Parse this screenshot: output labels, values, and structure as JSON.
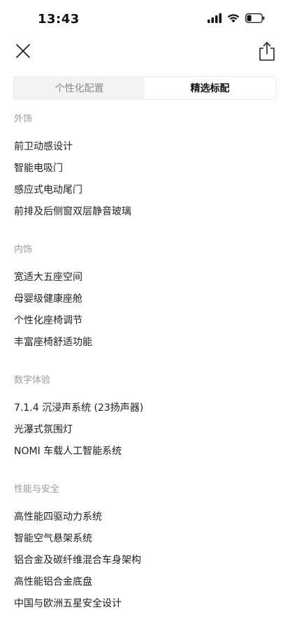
{
  "status_bar": {
    "time": "13:43"
  },
  "icons": {
    "close": "close-icon",
    "share": "share-icon",
    "signal": "signal-icon",
    "wifi": "wifi-icon",
    "battery": "battery-icon"
  },
  "tabs": [
    {
      "label": "个性化配置",
      "active": false
    },
    {
      "label": "精选标配",
      "active": true
    }
  ],
  "sections": [
    {
      "title": "外饰",
      "items": [
        "前卫动感设计",
        "智能电吸门",
        "感应式电动尾门",
        "前排及后侧窗双层静音玻璃"
      ]
    },
    {
      "title": "内饰",
      "items": [
        "宽适大五座空间",
        "母婴级健康座舱",
        "个性化座椅调节",
        "丰富座椅舒适功能"
      ]
    },
    {
      "title": "数字体验",
      "items": [
        "7.1.4 沉浸声系统 (23扬声器)",
        "光瀑式氛围灯",
        "NOMI 车载人工智能系统"
      ]
    },
    {
      "title": "性能与安全",
      "items": [
        "高性能四驱动力系统",
        "智能空气悬架系统",
        "铝合金及碳纤维混合车身架构",
        "高性能铝合金底盘",
        "中国与欧洲五星安全设计"
      ]
    }
  ],
  "colors": {
    "section_title": "#9a9a9a",
    "tab_inactive_bg": "#f3f3f3",
    "tab_active_bg": "#ffffff"
  }
}
